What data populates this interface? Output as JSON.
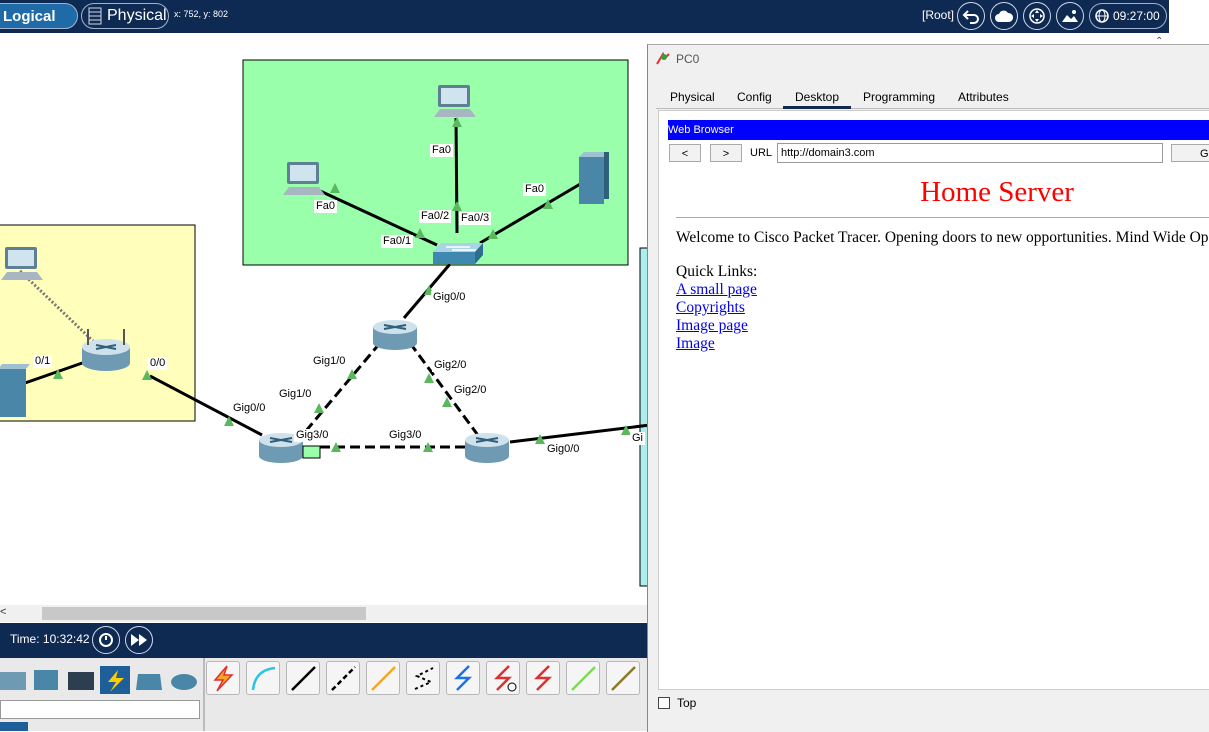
{
  "topbar": {
    "logical_label": "Logical",
    "physical_label": "Physical",
    "coords": "x: 752, y: 802",
    "root_label": "[Root]",
    "clock": "09:27:00"
  },
  "topology": {
    "labels": {
      "pc_top_fa0": "Fa0",
      "pc_left_fa0": "Fa0",
      "server_fa0": "Fa0",
      "sw_fa02": "Fa0/2",
      "sw_fa03": "Fa0/3",
      "sw_fa01": "Fa0/1",
      "r1_gig00": "Gig0/0",
      "r1_gig10": "Gig1/0",
      "r1_gig20": "Gig2/0",
      "r2_gig10": "Gig1/0",
      "r2_gig30": "Gig3/0",
      "r2_gig00": "Gig0/0",
      "r3_gig20": "Gig2/0",
      "r3_gig30": "Gig3/0",
      "r3_gig00": "Gig0/0",
      "edge_gig": "Gi",
      "wr_01": "0/1",
      "wr_00": "0/0"
    }
  },
  "bottombar": {
    "time": "Time: 10:32:42"
  },
  "pc0": {
    "title": "PC0",
    "tabs": [
      "Physical",
      "Config",
      "Desktop",
      "Programming",
      "Attributes"
    ],
    "active_tab": "Desktop",
    "browser": {
      "title": "Web Browser",
      "back": "<",
      "forward": ">",
      "url_label": "URL",
      "url": "http://domain3.com",
      "go": "Go",
      "heading": "Home Server",
      "welcome": "Welcome to Cisco Packet Tracer. Opening doors to new opportunities. Mind Wide Open.",
      "quick_links_label": "Quick Links:",
      "links": [
        "A small page",
        "Copyrights",
        "Image page",
        "Image"
      ]
    },
    "top_checkbox_label": "Top"
  },
  "colors": {
    "topbar_bg": "#0f2a52",
    "zone_green": "#99ffaa",
    "zone_yellow": "#ffffbb",
    "link_port": "#5cb85c",
    "heading_red": "#ff0000",
    "browser_titlebar": "#0000ff"
  }
}
